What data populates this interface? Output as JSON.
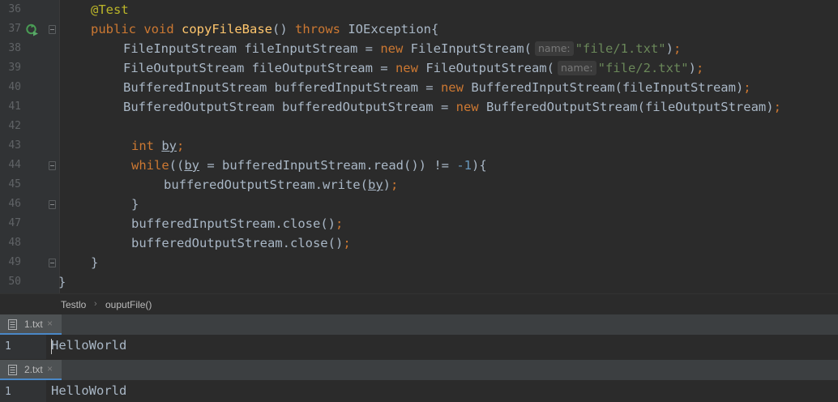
{
  "editor": {
    "lines": [
      {
        "num": "36"
      },
      {
        "num": "37"
      },
      {
        "num": "38"
      },
      {
        "num": "39"
      },
      {
        "num": "40"
      },
      {
        "num": "41"
      },
      {
        "num": "42"
      },
      {
        "num": "43"
      },
      {
        "num": "44"
      },
      {
        "num": "45"
      },
      {
        "num": "46"
      },
      {
        "num": "47"
      },
      {
        "num": "48"
      },
      {
        "num": "49"
      },
      {
        "num": "50"
      }
    ],
    "tokens": {
      "annotation": "@Test",
      "public": "public",
      "void": "void",
      "method_name": "copyFileBase",
      "throws": "throws",
      "exception": "IOException",
      "fis_type": "FileInputStream",
      "fis_var": "fileInputStream",
      "fos_type": "FileOutputStream",
      "fos_var": "fileOutputStream",
      "bis_type": "BufferedInputStream",
      "bis_var": "bufferedInputStream",
      "bos_type": "BufferedOutputStream",
      "bos_var": "bufferedOutputStream",
      "new": "new",
      "hint_name": "name:",
      "str_file1": "\"file/1.txt\"",
      "str_file2": "\"file/2.txt\"",
      "int": "int",
      "by": "by",
      "while": "while",
      "read": "read",
      "write": "write",
      "close": "close",
      "minus_one": "-1"
    }
  },
  "breadcrumb": {
    "items": [
      "Testlo",
      "ouputFile()"
    ],
    "separator": "›"
  },
  "file_tabs": [
    {
      "label": "1.txt",
      "close": "×",
      "line_num": "1",
      "content": "HelloWorld"
    },
    {
      "label": "2.txt",
      "close": "×",
      "line_num": "1",
      "content": "HelloWorld"
    }
  ],
  "colors": {
    "background": "#2b2b2b",
    "gutter": "#313335",
    "keyword": "#cc7832",
    "annotation": "#bbb529",
    "method": "#ffc66d",
    "string": "#6a8759",
    "number": "#6897bb",
    "text": "#a9b7c6",
    "tab_accent": "#4a88c7"
  },
  "icons": [
    "run-test-icon",
    "fold-marker-icon",
    "text-file-icon",
    "close-icon"
  ]
}
